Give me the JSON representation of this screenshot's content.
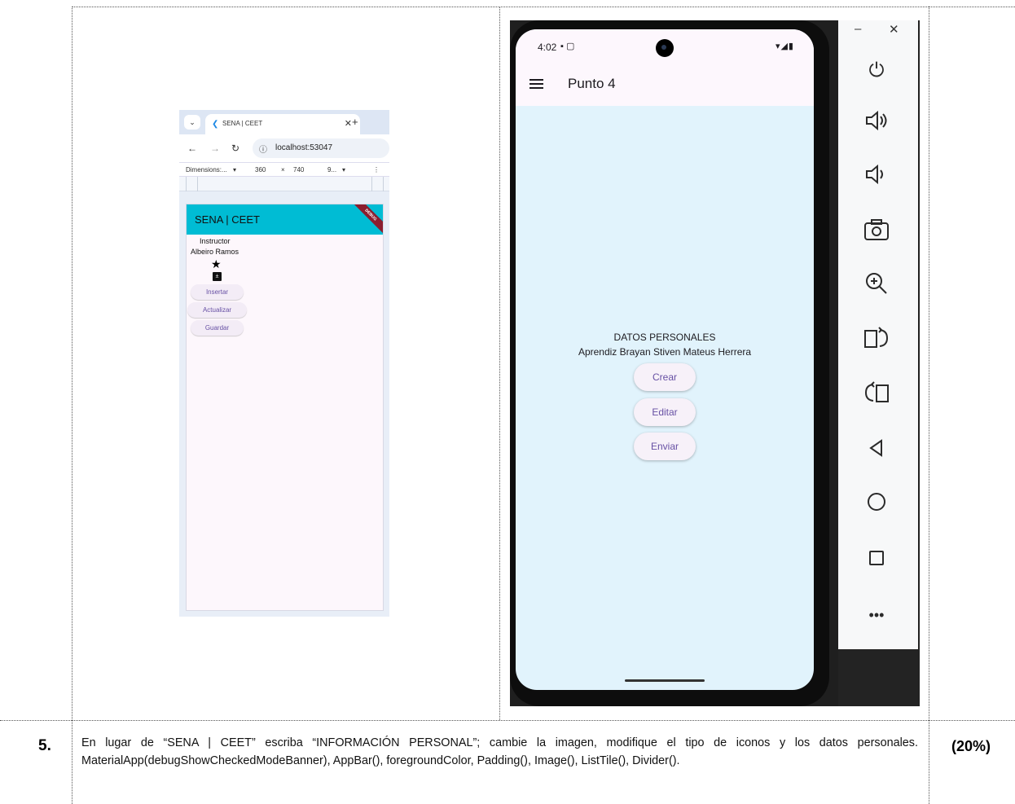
{
  "browser": {
    "tab_title": "SENA | CEET",
    "url": "localhost:53047",
    "dimensions_label": "Dimensions:...",
    "width": "360",
    "times": "×",
    "height": "740",
    "zoom": "9...",
    "app": {
      "title": "SENA | CEET",
      "debug_banner": "DEBUG",
      "role": "Instructor",
      "name": "Albeiro Ramos",
      "buttons": [
        "Insertar",
        "Actualizar",
        "Guardar"
      ]
    }
  },
  "emulator": {
    "status_time": "4:02",
    "app_title": "Punto 4",
    "heading": "DATOS PERSONALES",
    "subtitle": "Aprendiz Brayan Stiven Mateus Herrera",
    "buttons": [
      "Crear",
      "Editar",
      "Enviar"
    ],
    "side_controls": [
      "power-icon",
      "volume-up-icon",
      "volume-down-icon",
      "camera-icon",
      "zoom-in-icon",
      "rotate-right-icon",
      "rotate-left-icon",
      "back-icon",
      "home-icon",
      "overview-icon",
      "more-icon"
    ]
  },
  "task": {
    "number": "5.",
    "description": "En lugar de “SENA | CEET” escriba “INFORMACIÓN PERSONAL”; cambie la imagen, modifique el tipo de iconos y los datos personales. MaterialApp(debugShowCheckedModeBanner), AppBar(), foregroundColor, Padding(), Image(), ListTile(), Divider().",
    "weight": "(20%)"
  }
}
